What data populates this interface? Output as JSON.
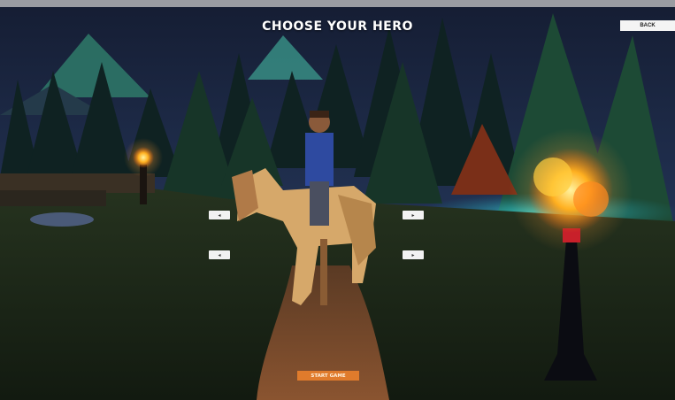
{
  "header": {
    "title": "CHOOSE YOUR HERO"
  },
  "nav": {
    "back_label": "BACK"
  },
  "selectors": {
    "left_top_arrow": "◂",
    "right_top_arrow": "▸",
    "left_bottom_arrow": "◂",
    "right_bottom_arrow": "▸"
  },
  "actions": {
    "start_label": "START GAME"
  },
  "colors": {
    "accent": "#e07b2c",
    "sky": "#1c2a46",
    "ground": "#1e2a18",
    "path": "#7a4a2c",
    "torch_flame": "#ffb020",
    "water_glow": "#2ee6e6"
  },
  "icons": {
    "left_arrow": "left-arrow-icon",
    "right_arrow": "right-arrow-icon"
  }
}
